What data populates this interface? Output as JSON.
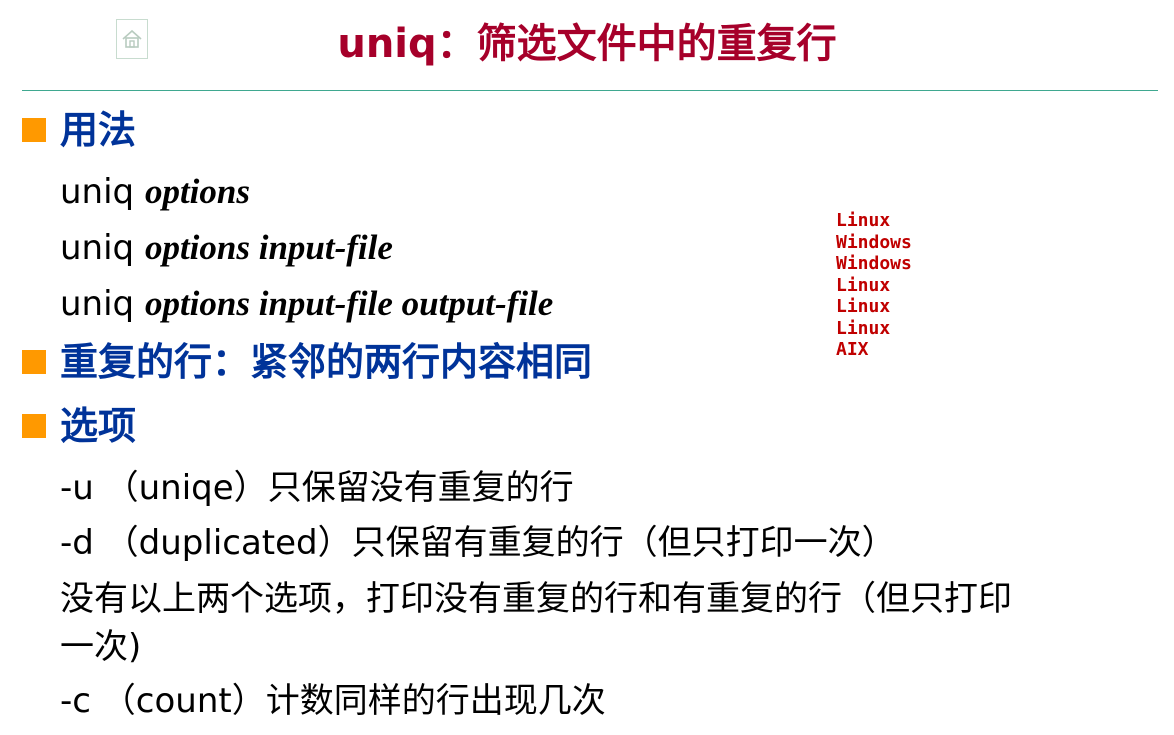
{
  "title": "uniq：筛选文件中的重复行",
  "icons": {
    "home": "home-icon"
  },
  "colors": {
    "title": "#a6002a",
    "heading": "#003399",
    "bullet": "#ff9900",
    "rule": "#3fa890",
    "sample": "#c00000"
  },
  "usage": {
    "heading": "用法",
    "lines": [
      {
        "cmd": "uniq ",
        "args": "options"
      },
      {
        "cmd": "uniq ",
        "args": "options input-file"
      },
      {
        "cmd": "uniq ",
        "args": "options input-file output-file"
      }
    ]
  },
  "duplicate": {
    "heading": "重复的行：紧邻的两行内容相同"
  },
  "options": {
    "heading": "选项",
    "lines": [
      "-u （uniqe）只保留没有重复的行",
      "-d （duplicated）只保留有重复的行（但只打印一次）",
      "没有以上两个选项，打印没有重复的行和有重复的行（但只打印",
      "一次)",
      "-c （count）计数同样的行出现几次"
    ]
  },
  "sample_file": {
    "lines": [
      "Linux",
      "Windows",
      "Windows",
      "Linux",
      "Linux",
      "Linux",
      "AIX"
    ]
  }
}
